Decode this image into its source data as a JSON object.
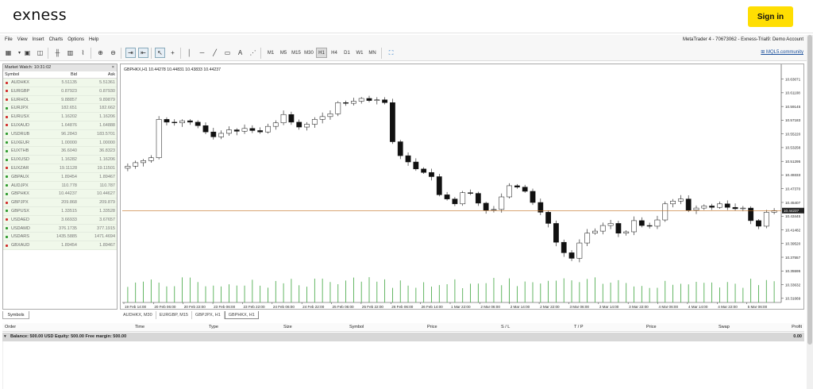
{
  "site": {
    "logo": "exness",
    "signin_label": "Sign in"
  },
  "menu": {
    "items": [
      "File",
      "View",
      "Insert",
      "Charts",
      "Options",
      "Help"
    ],
    "account": "MetaTrader 4 - 70673062 - Exness-Trial9: Demo Account"
  },
  "toolbar": {
    "timeframes": [
      "M1",
      "M5",
      "M15",
      "M30",
      "H1",
      "H4",
      "D1",
      "W1",
      "MN"
    ],
    "active_timeframe": "H1",
    "mql_link": "MQL5.community"
  },
  "market_watch": {
    "title": "Market Watch: 10:31:02",
    "headers": {
      "symbol": "Symbol",
      "bid": "Bid",
      "ask": "Ask"
    },
    "rows": [
      {
        "symbol": "AUDHKX",
        "bid": "5.51135",
        "ask": "5.51361",
        "dir": "down"
      },
      {
        "symbol": "EURGBP",
        "bid": "0.87923",
        "ask": "0.87930",
        "dir": "down"
      },
      {
        "symbol": "EURHOL",
        "bid": "9.88857",
        "ask": "9.89879",
        "dir": "down"
      },
      {
        "symbol": "EURJPX",
        "bid": "182.651",
        "ask": "182.662",
        "dir": "up"
      },
      {
        "symbol": "EURUSX",
        "bid": "1.16202",
        "ask": "1.16206",
        "dir": "down"
      },
      {
        "symbol": "EUXAUD",
        "bid": "1.64876",
        "ask": "1.64888",
        "dir": "down"
      },
      {
        "symbol": "USDRUB",
        "bid": "96.2843",
        "ask": "183.5701",
        "dir": "up"
      },
      {
        "symbol": "EUXEUR",
        "bid": "1.00000",
        "ask": "1.00000",
        "dir": "up"
      },
      {
        "symbol": "EUXTHB",
        "bid": "36.6040",
        "ask": "36.8323",
        "dir": "up"
      },
      {
        "symbol": "EUXUSD",
        "bid": "1.16282",
        "ask": "1.16206",
        "dir": "up"
      },
      {
        "symbol": "EUXZAR",
        "bid": "19.11128",
        "ask": "19.11501",
        "dir": "down"
      },
      {
        "symbol": "GBPAUX",
        "bid": "1.89454",
        "ask": "1.89467",
        "dir": "up"
      },
      {
        "symbol": "AUDJPX",
        "bid": "110.778",
        "ask": "110.787",
        "dir": "up"
      },
      {
        "symbol": "GBPHKX",
        "bid": "10.44237",
        "ask": "10.44627",
        "dir": "up"
      },
      {
        "symbol": "GBPJPX",
        "bid": "209.868",
        "ask": "209.879",
        "dir": "down"
      },
      {
        "symbol": "GBPUSX",
        "bid": "1.33515",
        "ask": "1.33528",
        "dir": "up"
      },
      {
        "symbol": "USDAED",
        "bid": "3.66933",
        "ask": "3.67657",
        "dir": "down"
      },
      {
        "symbol": "USDAMD",
        "bid": "376.1735",
        "ask": "377.1915",
        "dir": "up"
      },
      {
        "symbol": "USDARS",
        "bid": "1435.5885",
        "ask": "1471.4694",
        "dir": "up"
      },
      {
        "symbol": "GBXAUD",
        "bid": "1.89454",
        "ask": "1.89467",
        "dir": "down"
      }
    ],
    "tab": "Symbols"
  },
  "chart": {
    "header": "GBPHKX,H1  10.44278 10.44831 10.43833 10.44237",
    "current_price": "10.44237",
    "y_ticks": [
      "10.63071",
      "10.61108",
      "10.59145",
      "10.57183",
      "10.55220",
      "10.53258",
      "10.51295",
      "10.49333",
      "10.47370",
      "10.45407",
      "10.43445",
      "10.41482",
      "10.39520",
      "10.37557",
      "10.35595",
      "10.33632",
      "10.31669"
    ],
    "x_ticks": [
      "19 Feb 14:00",
      "20 Feb 06:00",
      "20 Feb 22:00",
      "23 Feb 06:00",
      "23 Feb 22:00",
      "24 Feb 06:00",
      "24 Feb 22:00",
      "25 Feb 06:00",
      "25 Feb 22:00",
      "26 Feb 06:00",
      "26 Feb 14:00",
      "1 Mar 22:00",
      "2 Mar 06:00",
      "2 Mar 14:00",
      "2 Mar 22:00",
      "3 Mar 06:00",
      "3 Mar 14:00",
      "3 Mar 22:00",
      "4 Mar 06:00",
      "4 Mar 14:00",
      "4 Mar 22:00",
      "5 Mar 06:00"
    ],
    "tabs": [
      "AUDHKX, M30",
      "EURGBP, M15",
      "GBPJPX, H1",
      "GBPHKX, H1"
    ],
    "active_tab": "GBPHKX, H1"
  },
  "chart_data": {
    "type": "candlestick",
    "symbol": "GBPHKX",
    "timeframe": "H1",
    "ylim": [
      10.3108,
      10.6405
    ],
    "current_price": 10.44237,
    "close": [
      10.506,
      10.511,
      10.514,
      10.518,
      10.573,
      10.569,
      10.568,
      10.571,
      10.569,
      10.564,
      10.555,
      10.548,
      10.553,
      10.558,
      10.556,
      10.56,
      10.557,
      10.555,
      10.563,
      10.568,
      10.58,
      10.569,
      10.562,
      10.566,
      10.573,
      10.577,
      10.581,
      10.597,
      10.596,
      10.599,
      10.603,
      10.6,
      10.601,
      10.597,
      10.541,
      10.521,
      10.512,
      10.502,
      10.497,
      10.491,
      10.465,
      10.459,
      10.452,
      10.468,
      10.467,
      10.453,
      10.443,
      10.444,
      10.462,
      10.478,
      10.476,
      10.47,
      10.454,
      10.44,
      10.424,
      10.397,
      10.382,
      10.374,
      10.396,
      10.41,
      10.413,
      10.421,
      10.424,
      10.41,
      10.412,
      10.428,
      10.421,
      10.42,
      10.429,
      10.452,
      10.456,
      10.459,
      10.443,
      10.446,
      10.449,
      10.447,
      10.452,
      10.447,
      10.445,
      10.446,
      10.428,
      10.42,
      10.44,
      10.442
    ],
    "volume_note": "volume histogram under price"
  },
  "terminal": {
    "headers": [
      "Order",
      "Time",
      "Type",
      "Size",
      "Symbol",
      "Price",
      "S / L",
      "T / P",
      "Price",
      "Swap",
      "Profit"
    ],
    "balance_line": "Balance: 500.00 USD  Equity: 500.00  Free margin: 500.00",
    "profit_total": "0.00"
  },
  "colors": {
    "accent": "#ffde02",
    "up_arrow": "#2e9b2e",
    "down_arrow": "#d22b2b",
    "volume": "#3da43d",
    "price_line": "#c07020",
    "row_bg": "#f0f8ea"
  }
}
